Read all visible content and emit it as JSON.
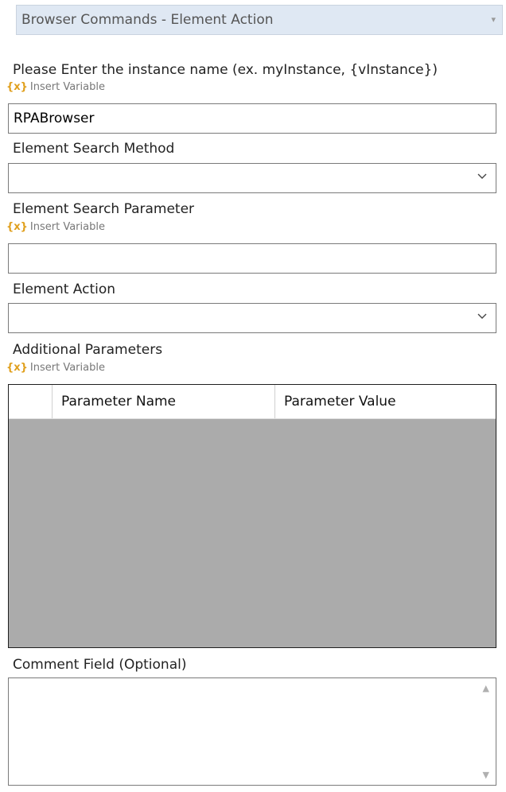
{
  "command": {
    "selected": "Browser Commands - Element Action"
  },
  "instance": {
    "label": "Please Enter the instance name (ex. myInstance, {vInstance})",
    "insert_variable": "Insert Variable",
    "value": "RPABrowser"
  },
  "search_method": {
    "label": "Element Search Method",
    "value": ""
  },
  "search_parameter": {
    "label": "Element Search Parameter",
    "insert_variable": "Insert Variable",
    "value": ""
  },
  "element_action": {
    "label": "Element Action",
    "value": ""
  },
  "additional_parameters": {
    "label": "Additional Parameters",
    "insert_variable": "Insert Variable",
    "columns": [
      "Parameter Name",
      "Parameter Value"
    ],
    "rows": []
  },
  "comment": {
    "label": "Comment Field (Optional)",
    "value": ""
  },
  "icons": {
    "insert_variable": "{x}",
    "dropdown": "chevron-down-icon",
    "scroll_up": "▲",
    "scroll_down": "▼",
    "cmd_dropdown": "▾"
  }
}
